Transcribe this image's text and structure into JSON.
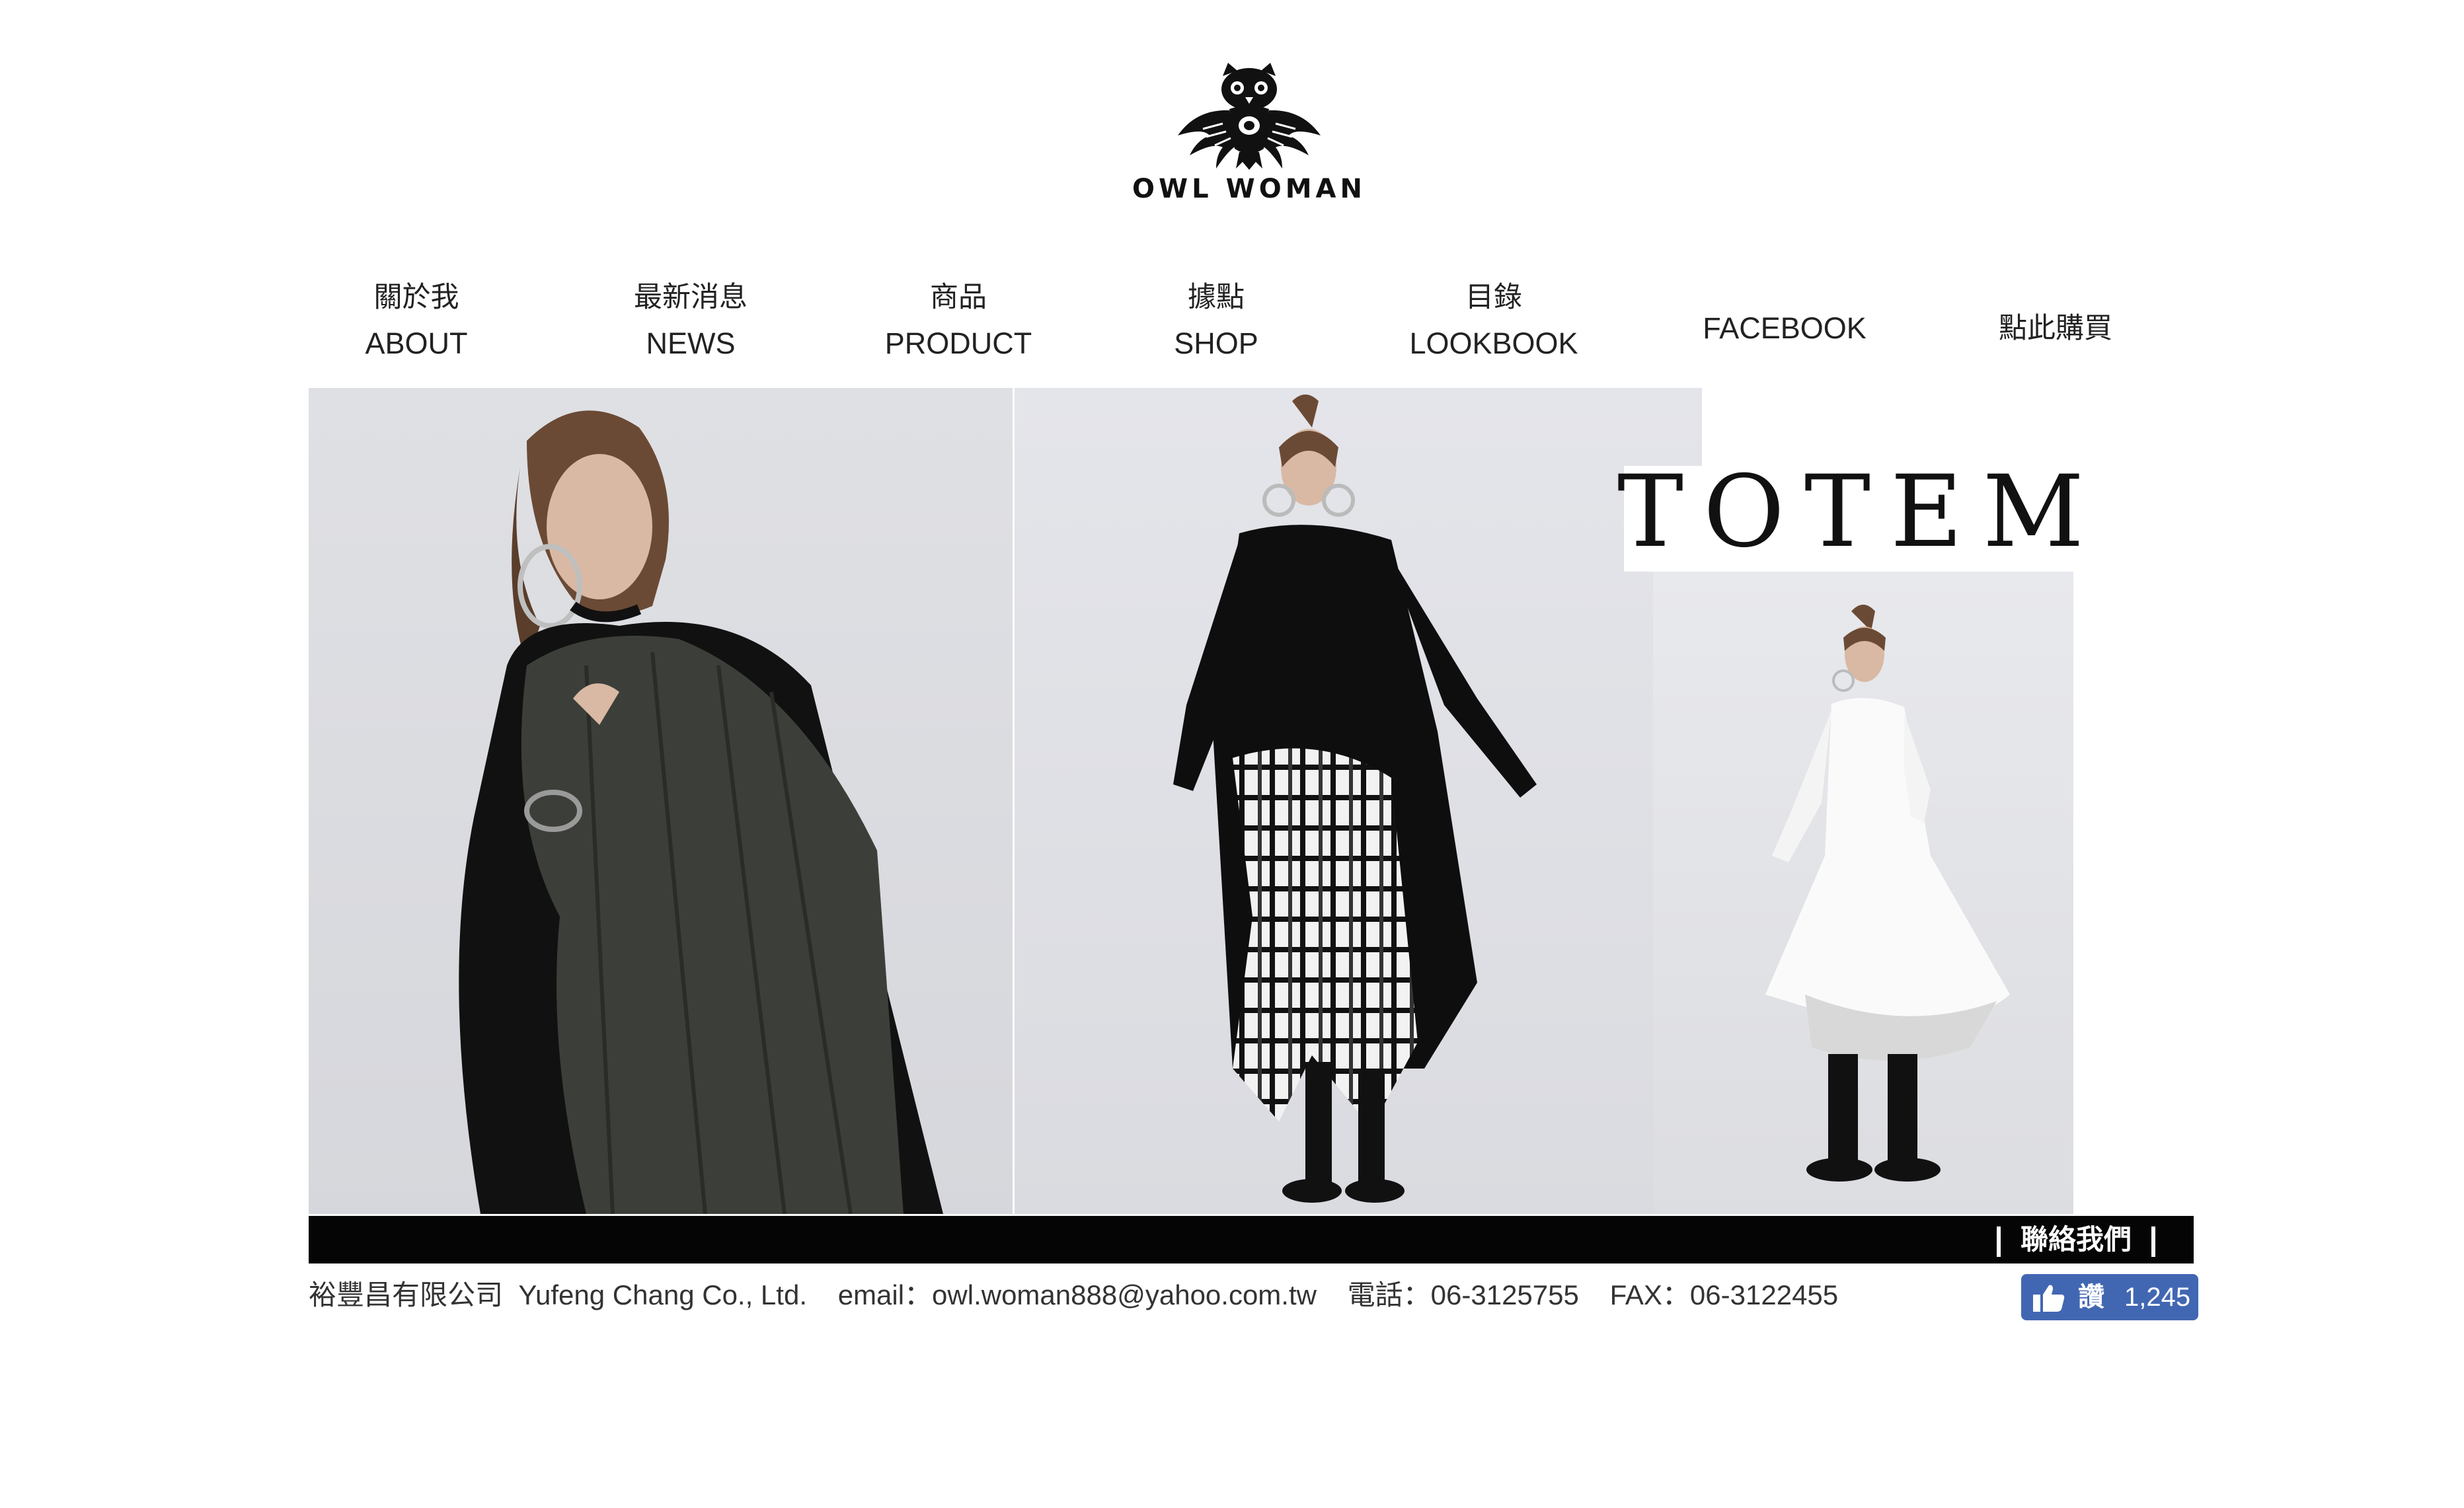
{
  "logo": {
    "text": "OWL WOMAN"
  },
  "nav": {
    "about": {
      "zh": "關於我",
      "en": "ABOUT"
    },
    "news": {
      "zh": "最新消息",
      "en": "NEWS"
    },
    "product": {
      "zh": "商品",
      "en": "PRODUCT"
    },
    "shop": {
      "zh": "據點",
      "en": "SHOP"
    },
    "lookbook": {
      "zh": "目錄",
      "en": "LOOKBOOK"
    },
    "facebook": "FACEBOOK",
    "buy": "點此購買"
  },
  "banner": {
    "title": "TOTEM"
  },
  "contact_bar": {
    "label": "聯絡我們"
  },
  "footer": {
    "company": "裕豐昌有限公司  Yufeng Chang Co., Ltd.",
    "email": "email：owl.woman888@yahoo.com.tw",
    "phone": "電話：06-3125755",
    "fax": "FAX：06-3122455"
  },
  "fb_like": {
    "label": "讚",
    "count": "1,245"
  },
  "colors": {
    "bar": "#050505",
    "facebook": "#4267b2",
    "background": "#ffffff"
  }
}
